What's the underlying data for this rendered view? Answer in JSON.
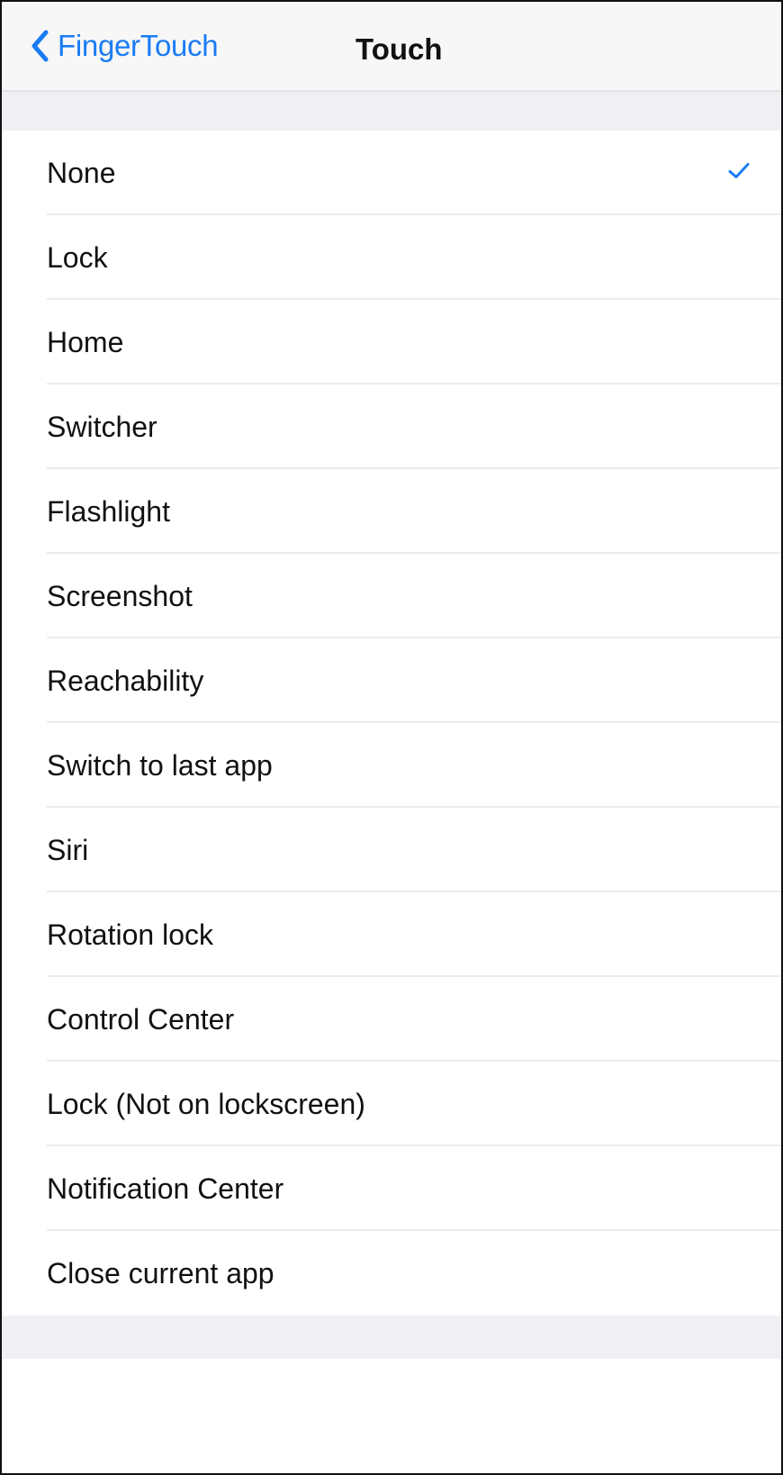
{
  "navbar": {
    "back_label": "FingerTouch",
    "title": "Touch"
  },
  "options": [
    {
      "label": "None",
      "selected": true
    },
    {
      "label": "Lock",
      "selected": false
    },
    {
      "label": "Home",
      "selected": false
    },
    {
      "label": "Switcher",
      "selected": false
    },
    {
      "label": "Flashlight",
      "selected": false
    },
    {
      "label": "Screenshot",
      "selected": false
    },
    {
      "label": "Reachability",
      "selected": false
    },
    {
      "label": "Switch to last app",
      "selected": false
    },
    {
      "label": "Siri",
      "selected": false
    },
    {
      "label": "Rotation lock",
      "selected": false
    },
    {
      "label": "Control Center",
      "selected": false
    },
    {
      "label": "Lock (Not on lockscreen)",
      "selected": false
    },
    {
      "label": "Notification Center",
      "selected": false
    },
    {
      "label": "Close current app",
      "selected": false
    }
  ],
  "icons": {
    "back": "chevron-left-icon",
    "selected": "checkmark-icon"
  },
  "colors": {
    "accent": "#1a7cf5",
    "grouped_background": "#efeff4"
  }
}
